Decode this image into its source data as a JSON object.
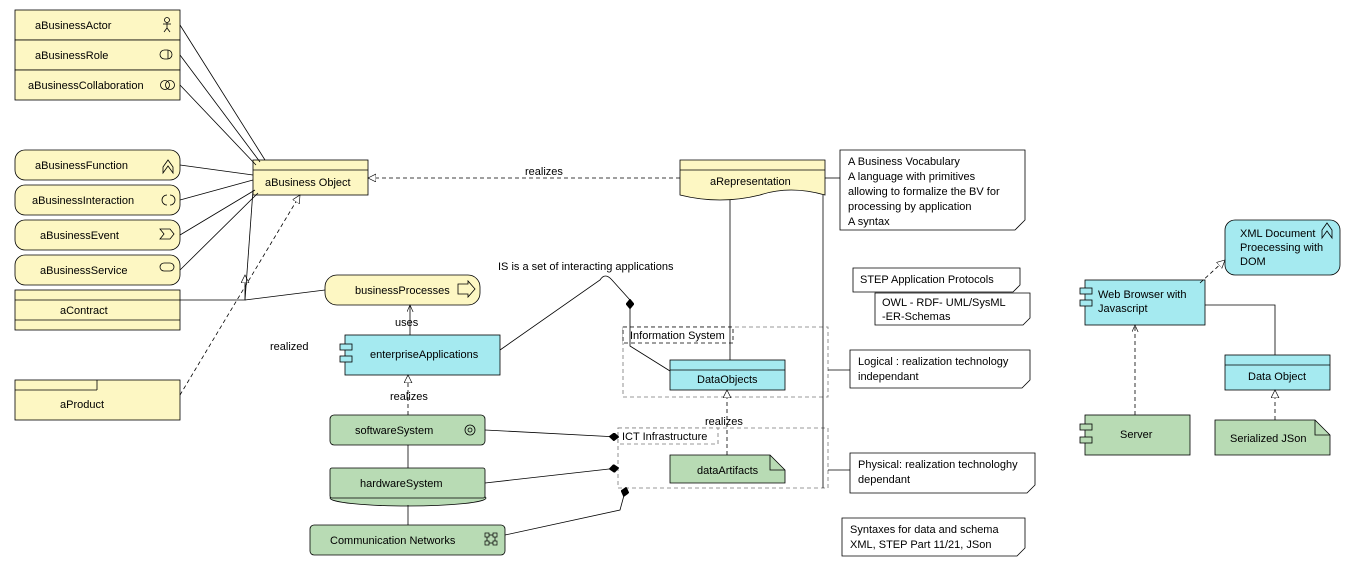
{
  "left_column": {
    "actor": "aBusinessActor",
    "role": "aBusinessRole",
    "collaboration": "aBusinessCollaboration",
    "function": "aBusinessFunction",
    "interaction": "aBusinessInteraction",
    "event": "aBusinessEvent",
    "service": "aBusinessService",
    "contract": "aContract",
    "product": "aProduct"
  },
  "center": {
    "business_object": "aBusiness Object",
    "business_processes": "businessProcesses",
    "enterprise_applications": "enterpriseApplications",
    "software_system": "softwareSystem",
    "hardware_system": "hardwareSystem",
    "communication_networks": "Communication Networks",
    "uses": "uses",
    "realizes1": "realizes",
    "realized": "realized",
    "realizes_label": "realizes",
    "is_set": "IS is a set of interacting applications",
    "ict": "ICT Infrastructure",
    "information_system": "Information System",
    "data_objects": "DataObjects",
    "data_artifacts": "dataArtifacts",
    "realizes2": "realizes"
  },
  "top_right": {
    "representation": "aRepresentation"
  },
  "notes": {
    "vocab1": "A Business Vocabulary",
    "vocab2": "A language with primitives",
    "vocab3": "allowing to formalize the BV for",
    "vocab4": "processing by application",
    "vocab5": "A syntax",
    "step1": "STEP Application Protocols",
    "step2": "OWL - RDF- UML/SysML",
    "step3": "-ER-Schemas",
    "logical1": "Logical : realization technology",
    "logical2": "independant",
    "physical1": "Physical: realization technologhy",
    "physical2": "dependant",
    "syntax1": "Syntaxes for data and schema",
    "syntax2": "XML, STEP Part 11/21, JSon"
  },
  "right_cluster": {
    "xml1": "XML Document",
    "xml2": "Proecessing with",
    "xml3": "DOM",
    "browser1": "Web Browser with",
    "browser2": "Javascript",
    "data_object": "Data Object",
    "server": "Server",
    "json": "Serialized JSon"
  }
}
